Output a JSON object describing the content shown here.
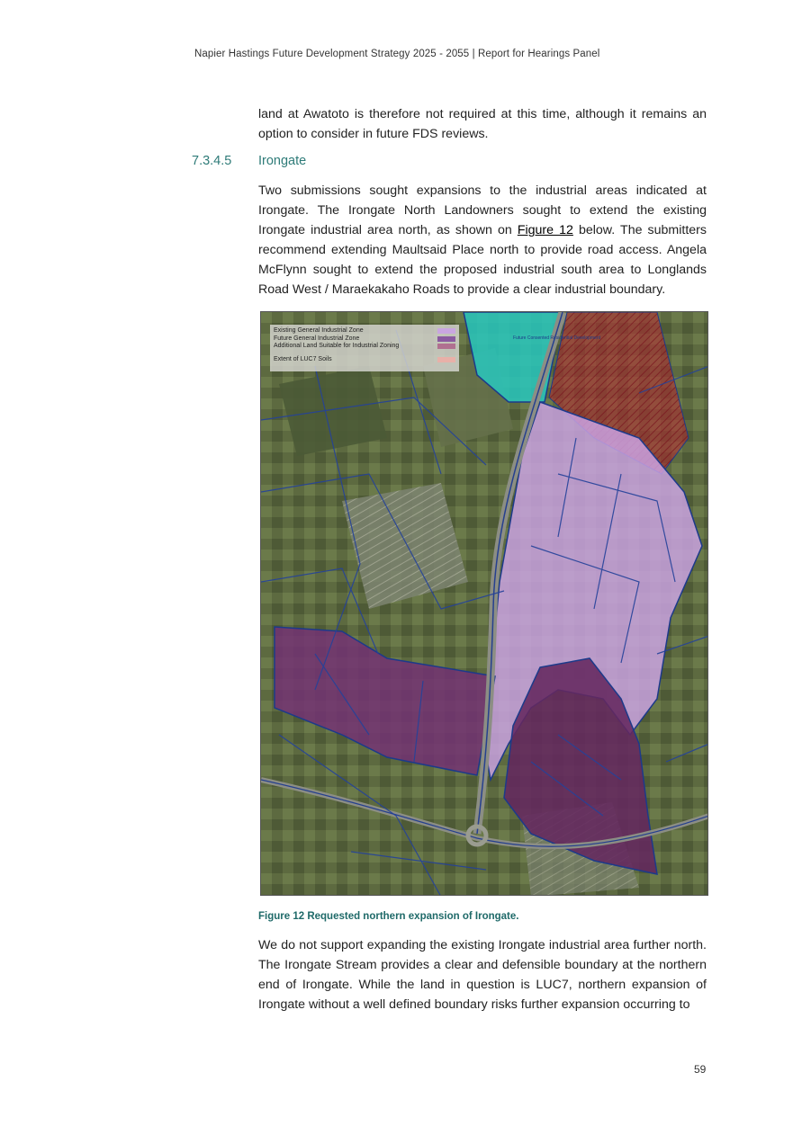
{
  "header": {
    "text": "Napier Hastings Future Development Strategy 2025 - 2055 | Report for Hearings Panel"
  },
  "intro_para": "land at Awatoto is therefore not required at this time, although it remains an option to consider in future FDS reviews.",
  "section": {
    "number": "7.3.4.5",
    "title": "Irongate"
  },
  "para1": {
    "before": "Two submissions sought expansions to the industrial areas indicated at Irongate. The Irongate North Landowners sought to extend the existing Irongate industrial area north, as shown on ",
    "ref": "Figure 12",
    "after": " below. The submitters recommend extending Maultsaid Place north to provide road access. Angela McFlynn sought to extend the proposed industrial south area to Longlands Road West / Maraekakaho Roads to provide a clear industrial boundary."
  },
  "figure": {
    "legend": [
      {
        "label": "Existing General Industrial Zone",
        "color": "#c9a6e0"
      },
      {
        "label": "Future General Industrial Zone",
        "color": "#8a5aa0"
      },
      {
        "label": "Additional Land Suitable for Industrial Zoning",
        "color": "#b07090"
      }
    ],
    "legend_extra": {
      "label": "Extent of LUC7 Soils",
      "color": "#e8b0a8"
    },
    "map_label": "Future Consented Residential Development",
    "caption": "Figure 12 Requested northern expansion of Irongate."
  },
  "para2": "We do not support expanding the existing Irongate industrial area further north. The Irongate Stream provides a clear and defensible boundary at the northern end of Irongate. While the land in question is LUC7, northern expansion of Irongate without a well defined boundary risks further expansion occurring to",
  "page_number": "59"
}
